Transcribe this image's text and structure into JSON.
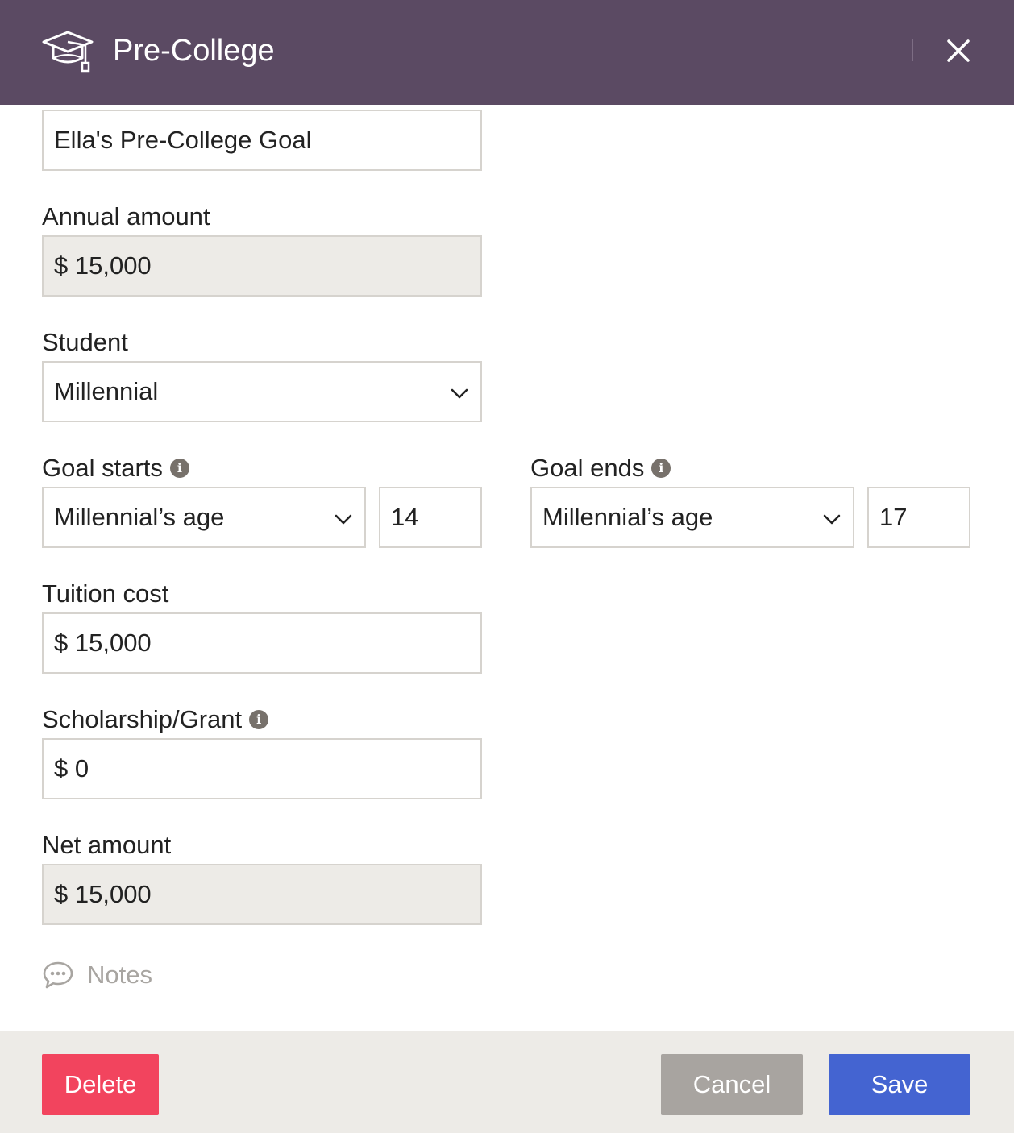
{
  "header": {
    "title": "Pre-College",
    "icon": "graduation-cap-icon",
    "background_color": "#5b4a63"
  },
  "form": {
    "goal_name_value": "Ella's Pre-College Goal",
    "annual_amount": {
      "label": "Annual amount",
      "value": "$ 15,000"
    },
    "student": {
      "label": "Student",
      "selected": "Millennial"
    },
    "goal_starts": {
      "label": "Goal starts",
      "reference": "Millennial’s age",
      "age": "14"
    },
    "goal_ends": {
      "label": "Goal ends",
      "reference": "Millennial’s age",
      "age": "17"
    },
    "tuition_cost": {
      "label": "Tuition cost",
      "value": "$ 15,000"
    },
    "scholarship": {
      "label": "Scholarship/Grant",
      "value": "$ 0"
    },
    "net_amount": {
      "label": "Net amount",
      "value": "$ 15,000"
    },
    "notes_label": "Notes"
  },
  "footer": {
    "delete_label": "Delete",
    "cancel_label": "Cancel",
    "save_label": "Save",
    "colors": {
      "delete": "#f2445e",
      "cancel": "#a8a4a0",
      "save": "#4464d1"
    }
  }
}
